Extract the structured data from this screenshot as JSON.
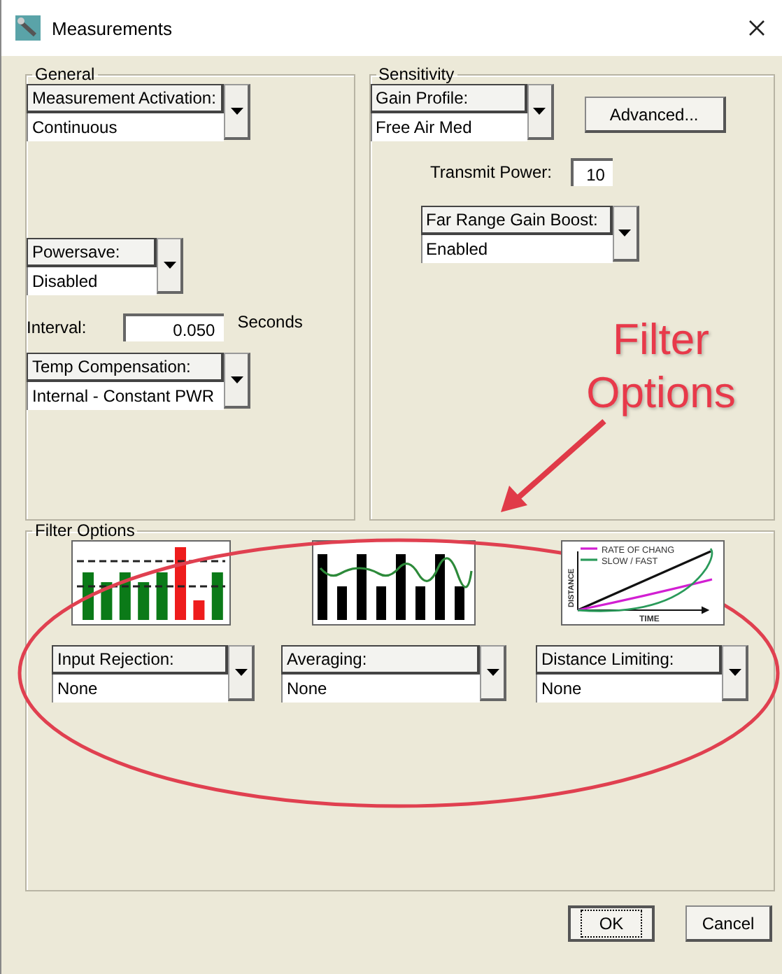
{
  "window": {
    "title": "Measurements"
  },
  "general": {
    "title": "General",
    "measurement_activation": {
      "label": "Measurement Activation:",
      "value": "Continuous"
    },
    "powersave": {
      "label": "Powersave:",
      "value": "Disabled"
    },
    "interval": {
      "label": "Interval:",
      "value": "0.050",
      "unit": "Seconds"
    },
    "temp_compensation": {
      "label": "Temp Compensation:",
      "value": "Internal - Constant PWR"
    }
  },
  "sensitivity": {
    "title": "Sensitivity",
    "gain_profile": {
      "label": "Gain Profile:",
      "value": "Free Air Med"
    },
    "advanced_button": "Advanced...",
    "transmit_power": {
      "label": "Transmit Power:",
      "value": "10"
    },
    "far_range_gain_boost": {
      "label": "Far Range Gain Boost:",
      "value": "Enabled"
    }
  },
  "filter_options": {
    "title": "Filter Options",
    "filters": [
      {
        "kind": "rejection",
        "label": "Input Rejection:",
        "value": "None"
      },
      {
        "kind": "averaging",
        "label": "Averaging:",
        "value": "None"
      },
      {
        "kind": "distance",
        "label": "Distance Limiting:",
        "value": "None",
        "legend": [
          "RATE OF CHANG",
          "SLOW / FAST"
        ],
        "xlabel": "TIME",
        "ylabel": "DISTANCE"
      }
    ]
  },
  "buttons": [
    {
      "label": "OK",
      "default": true
    },
    {
      "label": "Cancel",
      "default": false
    }
  ],
  "annotation": {
    "text": "Filter Options"
  }
}
